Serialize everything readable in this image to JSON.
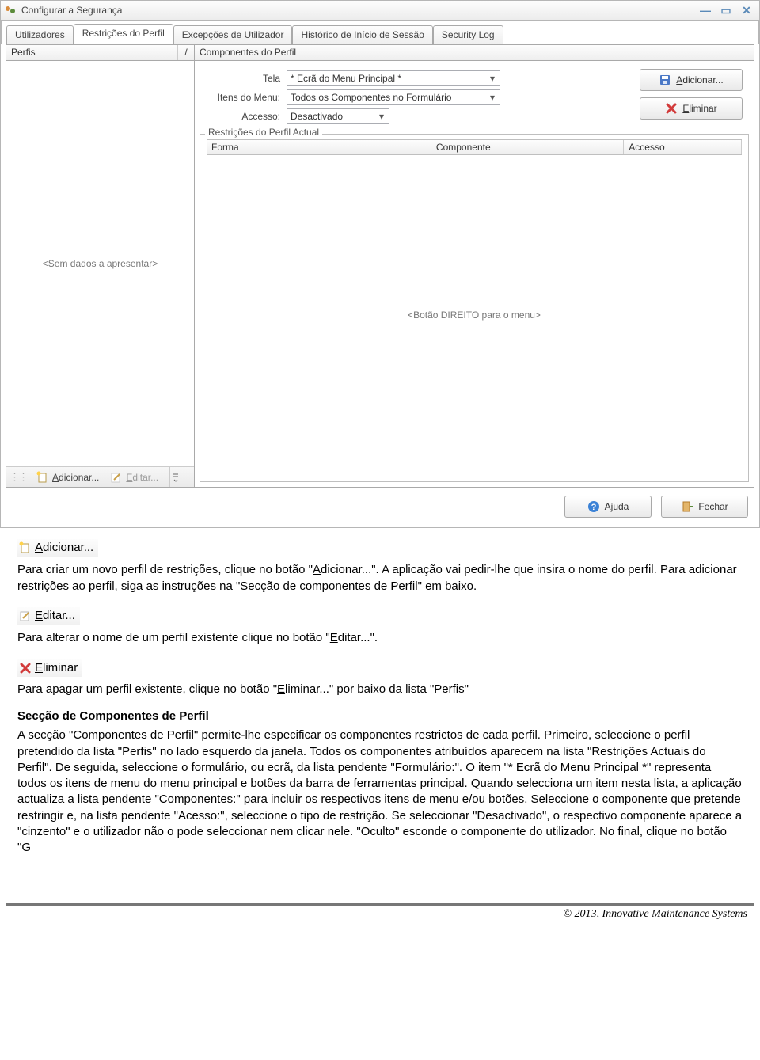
{
  "window": {
    "title": "Configurar a Segurança"
  },
  "tabs": [
    "Utilizadores",
    "Restrições do Perfil",
    "Excepções de Utilizador",
    "Histórico de Início de Sessão",
    "Security Log"
  ],
  "left": {
    "header": "Perfis",
    "sort": "/",
    "empty": "<Sem dados a apresentar>",
    "toolbar": {
      "add": "Adicionar...",
      "edit": "Editar..."
    }
  },
  "right": {
    "components_header": "Componentes do Perfil",
    "form": {
      "tela_label": "Tela",
      "tela_value": "* Ecrã do Menu Principal *",
      "itens_label": "Itens do Menu:",
      "itens_value": "Todos os Componentes no Formulário",
      "accesso_label": "Accesso:",
      "accesso_value": "Desactivado"
    },
    "buttons": {
      "add": "Adicionar...",
      "del": "Eliminar"
    },
    "group_title": "Restrições do Perfil Actual",
    "grid": {
      "c1": "Forma",
      "c2": "Componente",
      "c3": "Accesso"
    },
    "grid_empty": "<Botão DIREITO para o menu>"
  },
  "footer_buttons": {
    "help": "Ajuda",
    "close": "Fechar"
  },
  "doc": {
    "add_label": "Adicionar...",
    "p1a": "Para criar um novo perfil de restrições, clique no botão \"",
    "p1b": "dicionar...\". A aplicação vai pedir-lhe que insira o nome do perfil. Para adicionar restrições ao perfil, siga as instruções na \"Secção de componentes de Perfil\" em baixo.",
    "edit_label": "Editar...",
    "p2a": "Para alterar o nome de um perfil existente clique no botão \"",
    "p2b": "ditar...\".",
    "del_label": "Eliminar",
    "p3a": "Para apagar um perfil existente, clique no botão \"",
    "p3b": "liminar...\" por baixo da lista \"Perfis\"",
    "h4": "Secção de Componentes de Perfil",
    "p4": "A secção \"Componentes de Perfil\" permite-lhe especificar os componentes restrictos de cada perfil. Primeiro, seleccione o perfil pretendido da lista \"Perfis\" no lado esquerdo da janela. Todos os componentes atribuídos aparecem na lista \"Restrições Actuais do Perfil\". De seguida, seleccione o formulário, ou ecrã, da lista pendente \"Formulário:\". O item \"* Ecrã do Menu Principal *\" representa todos os itens de menu do menu principal e botões da barra de ferramentas principal. Quando selecciona um item nesta lista, a aplicação actualiza a lista pendente \"Componentes:\" para incluir os respectivos itens de menu e/ou botões. Seleccione o componente que pretende restringir e, na lista pendente \"Acesso:\", seleccione o tipo de restrição. Se seleccionar \"Desactivado\", o respectivo componente aparece a \"cinzento\" e o utilizador não o pode seleccionar nem clicar nele. \"Oculto\" esconde o componente do utilizador. No final,  clique no botão \"G"
  },
  "copyright": "© 2013, Innovative Maintenance Systems"
}
